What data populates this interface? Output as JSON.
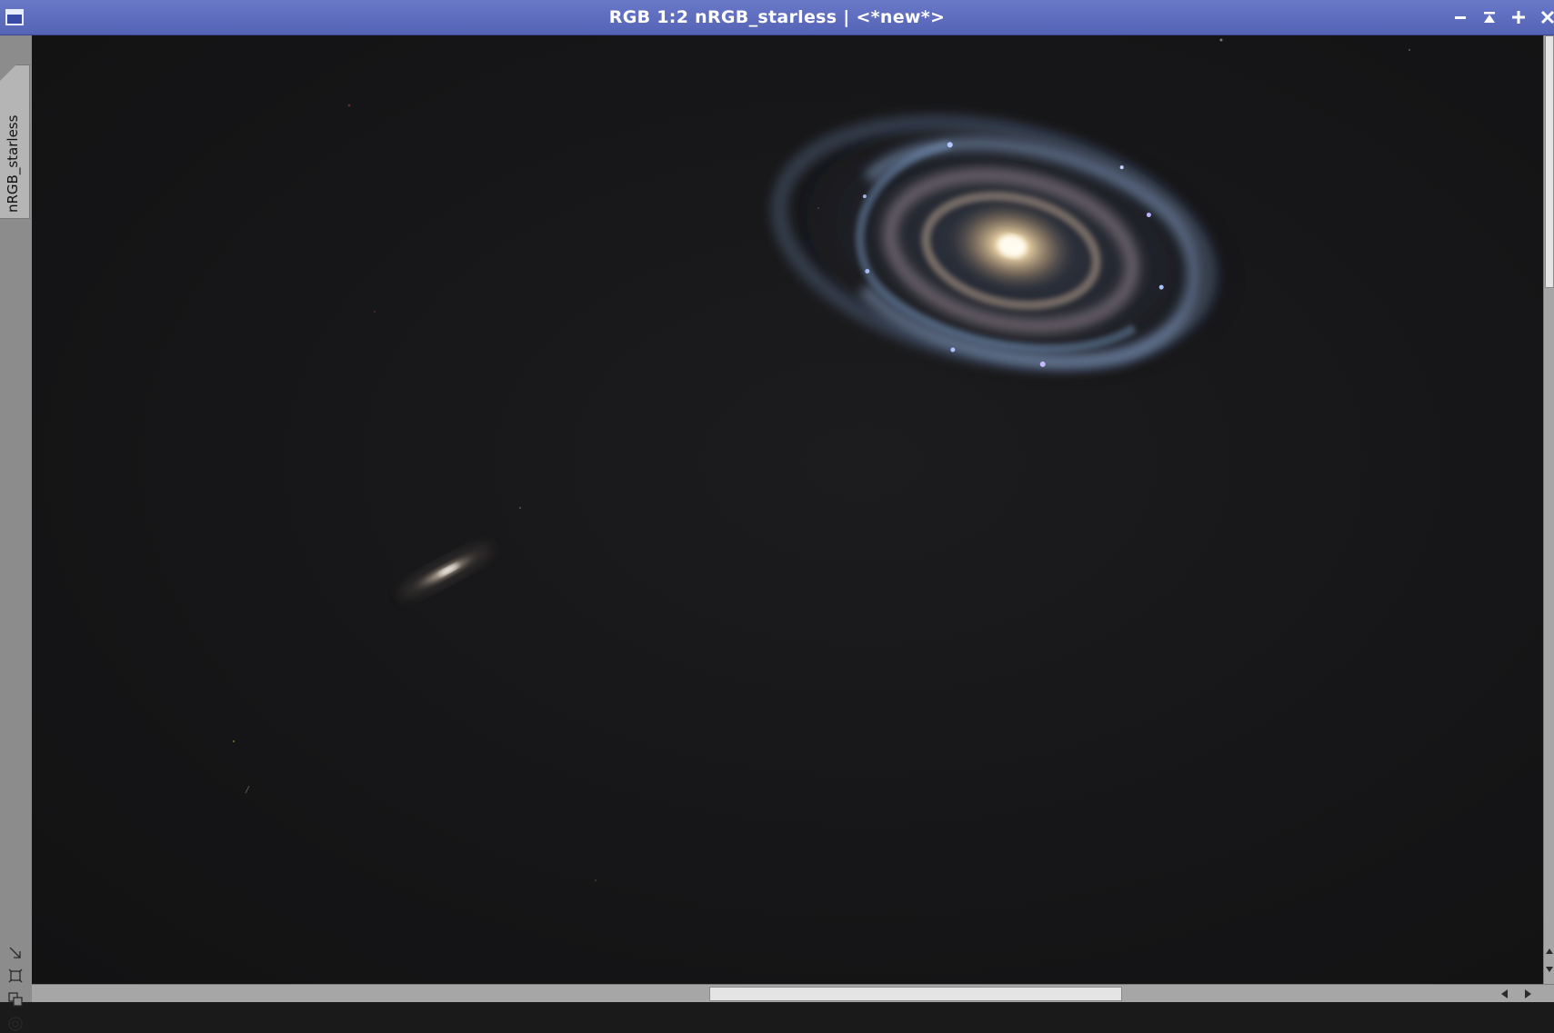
{
  "window": {
    "title": "RGB 1:2 nRGB_starless | <*new*>",
    "icon": "window-icon",
    "controls": {
      "minimize": "minimize-icon",
      "shade": "shade-icon",
      "maximize": "maximize-icon",
      "close": "close-icon"
    },
    "colors": {
      "titlebar": "#5a67bb",
      "frame": "#8f8f8f",
      "background": "#161618"
    }
  },
  "sidebar": {
    "tab_label": "nRGB_starless",
    "tools": [
      "auto-stretch-icon",
      "fit-view-icon",
      "clone-view-icon",
      "mask-icon"
    ]
  },
  "image": {
    "subject": "galaxy-field",
    "objects": [
      "barred-spiral-galaxy",
      "edge-on-galaxy"
    ]
  }
}
